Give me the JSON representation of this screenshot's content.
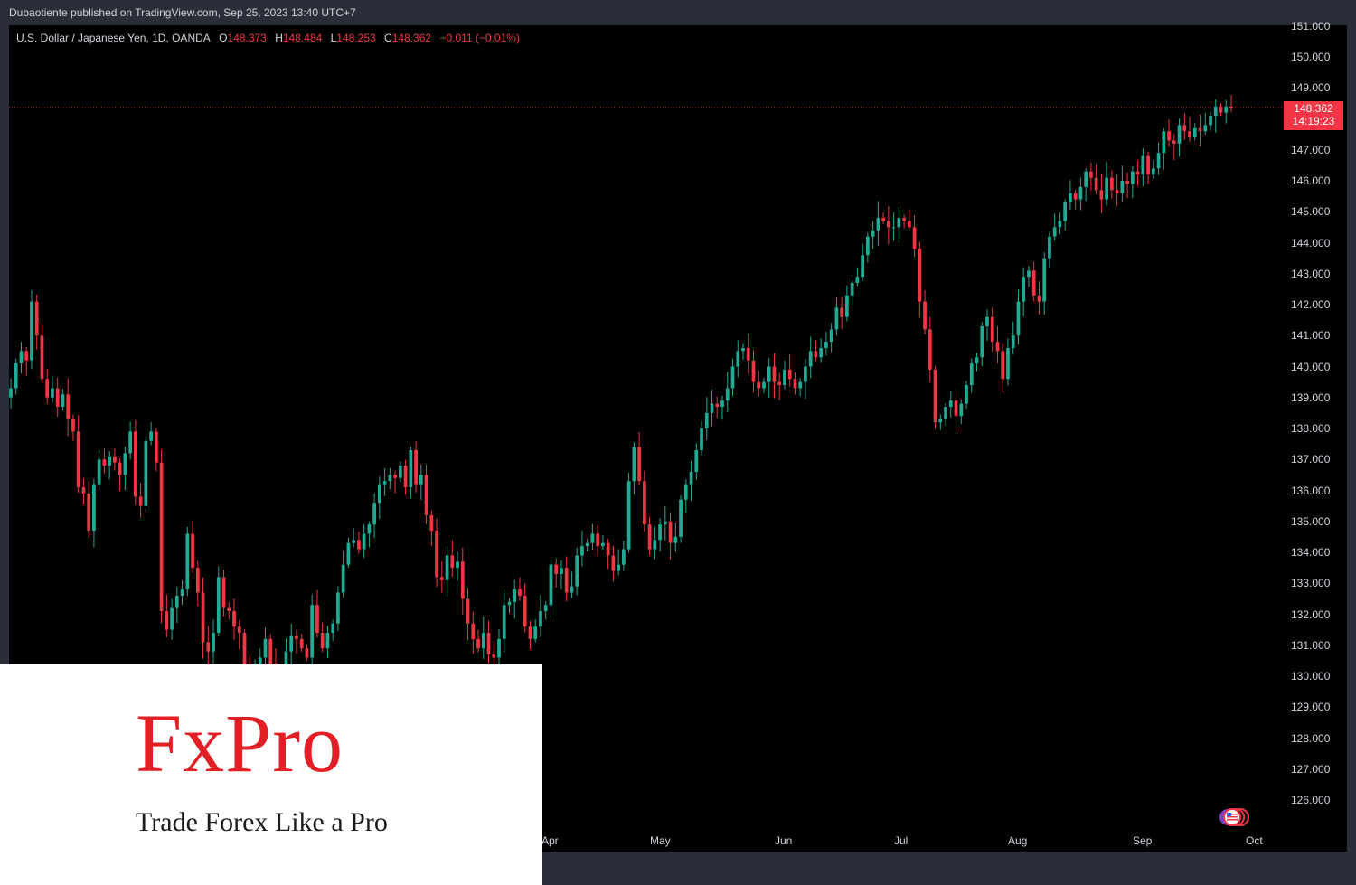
{
  "header": {
    "publish_text": "Dubaotiente published on TradingView.com, Sep 25, 2023 13:40 UTC+7"
  },
  "legend": {
    "symbol": "U.S. Dollar / Japanese Yen, 1D, OANDA",
    "open_label": "O",
    "open_value": "148.373",
    "high_label": "H",
    "high_value": "148.484",
    "low_label": "L",
    "low_value": "148.253",
    "close_label": "C",
    "close_value": "148.362",
    "change": "−0.011 (−0.01%)"
  },
  "price_tag": {
    "price": "148.362",
    "countdown": "14:19:23"
  },
  "logo": {
    "wordmark": "FxPro",
    "tagline": "Trade Forex Like a Pro"
  },
  "icons": {
    "flag_badges": "us-flag-icon"
  },
  "colors": {
    "up": "#22ab94",
    "down": "#f23645",
    "background": "#000000",
    "last_price_line": "#f23645"
  },
  "chart_data": {
    "type": "candlestick",
    "symbol": "USDJPY",
    "timeframe": "1D",
    "y_ticks": [
      "126.000",
      "127.000",
      "128.000",
      "129.000",
      "130.000",
      "131.000",
      "132.000",
      "133.000",
      "134.000",
      "135.000",
      "136.000",
      "137.000",
      "138.000",
      "139.000",
      "140.000",
      "141.000",
      "142.000",
      "143.000",
      "144.000",
      "145.000",
      "146.000",
      "147.000",
      "148.000",
      "149.000",
      "150.000",
      "151.000"
    ],
    "x_ticks": [
      "Apr",
      "May",
      "Jun",
      "Jul",
      "Aug",
      "Sep",
      "Oct"
    ],
    "ylim": [
      125.2,
      151.1
    ],
    "last_price": 148.362,
    "closes": [
      139.3,
      140.1,
      140.5,
      140.2,
      142.1,
      141.0,
      139.6,
      139.0,
      139.3,
      138.7,
      139.1,
      138.3,
      137.9,
      136.1,
      135.9,
      134.7,
      136.2,
      137.0,
      136.8,
      137.1,
      136.9,
      136.5,
      137.2,
      137.9,
      135.8,
      135.5,
      137.6,
      137.9,
      136.9,
      132.1,
      131.5,
      132.2,
      132.6,
      132.8,
      134.6,
      133.5,
      132.7,
      131.1,
      130.8,
      131.4,
      133.2,
      132.2,
      132.1,
      131.6,
      131.4,
      130.3,
      129.7,
      130.4,
      130.6,
      131.2,
      130.4,
      130.1,
      129.9,
      130.8,
      131.3,
      131.2,
      130.9,
      130.6,
      132.3,
      131.4,
      130.9,
      131.4,
      131.7,
      132.7,
      133.6,
      134.3,
      134.4,
      134.1,
      134.6,
      134.9,
      135.6,
      136.2,
      136.3,
      136.5,
      136.4,
      136.8,
      136.1,
      137.3,
      136.2,
      136.5,
      135.2,
      134.7,
      133.2,
      133.1,
      133.9,
      133.5,
      133.7,
      132.5,
      131.7,
      131.2,
      130.9,
      131.4,
      130.7,
      130.6,
      131.2,
      132.3,
      132.4,
      132.8,
      132.6,
      131.6,
      131.2,
      131.6,
      132.1,
      132.3,
      133.6,
      133.3,
      133.5,
      132.7,
      132.9,
      133.9,
      134.2,
      134.3,
      134.6,
      134.2,
      134.3,
      133.9,
      133.4,
      133.6,
      134.1,
      136.3,
      137.4,
      136.3,
      134.9,
      134.1,
      134.4,
      134.9,
      135.0,
      134.3,
      134.5,
      135.7,
      136.2,
      136.6,
      137.3,
      138.0,
      138.5,
      138.8,
      138.7,
      138.9,
      139.3,
      140.0,
      140.5,
      140.6,
      140.2,
      139.5,
      139.3,
      139.5,
      140.0,
      139.5,
      139.4,
      139.9,
      139.6,
      139.3,
      139.5,
      140.0,
      140.5,
      140.3,
      140.6,
      140.8,
      141.2,
      141.9,
      141.6,
      142.3,
      142.7,
      142.9,
      143.6,
      144.2,
      144.4,
      144.8,
      144.7,
      144.5,
      144.5,
      144.8,
      144.7,
      144.5,
      143.8,
      142.1,
      141.2,
      139.9,
      138.2,
      138.3,
      138.7,
      138.9,
      138.4,
      138.8,
      139.4,
      140.1,
      140.3,
      141.3,
      141.6,
      140.8,
      140.5,
      139.6,
      140.6,
      141.0,
      142.1,
      142.9,
      143.1,
      142.3,
      142.1,
      143.5,
      144.2,
      144.5,
      144.7,
      145.3,
      145.6,
      145.4,
      145.8,
      146.3,
      146.1,
      145.7,
      145.4,
      146.1,
      145.7,
      145.6,
      146.0,
      145.9,
      146.3,
      146.2,
      146.8,
      146.2,
      146.4,
      146.9,
      147.6,
      147.3,
      147.2,
      147.8,
      147.6,
      147.4,
      147.7,
      147.6,
      147.8,
      148.1,
      148.4,
      148.2,
      148.4,
      148.36
    ]
  }
}
